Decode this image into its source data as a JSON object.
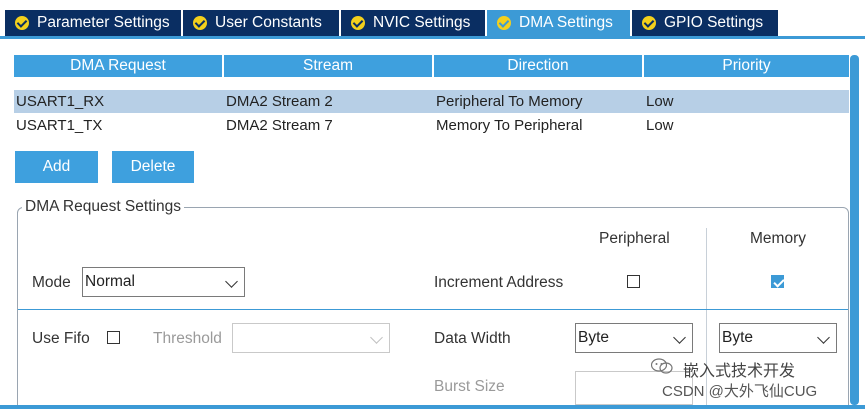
{
  "tabs": [
    {
      "label": "Parameter Settings",
      "active": false
    },
    {
      "label": "User Constants",
      "active": false
    },
    {
      "label": "NVIC Settings",
      "active": false
    },
    {
      "label": "DMA Settings",
      "active": true
    },
    {
      "label": "GPIO Settings",
      "active": false
    }
  ],
  "table": {
    "columns": [
      "DMA Request",
      "Stream",
      "Direction",
      "Priority"
    ],
    "rows": [
      [
        "USART1_RX",
        "DMA2 Stream 2",
        "Peripheral To Memory",
        "Low"
      ],
      [
        "USART1_TX",
        "DMA2 Stream 7",
        "Memory To Peripheral",
        "Low"
      ]
    ],
    "selected_row": 0
  },
  "buttons": {
    "add": "Add",
    "delete": "Delete"
  },
  "settings": {
    "legend": "DMA Request Settings",
    "peripheral_header": "Peripheral",
    "memory_header": "Memory",
    "mode_label": "Mode",
    "mode_value": "Normal",
    "increment_label": "Increment Address",
    "peripheral_increment": false,
    "memory_increment": true,
    "use_fifo_label": "Use Fifo",
    "use_fifo": false,
    "threshold_label": "Threshold",
    "threshold_value": "",
    "data_width_label": "Data Width",
    "peripheral_data_width": "Byte",
    "memory_data_width": "Byte",
    "burst_size_label": "Burst Size",
    "peripheral_burst_size": ""
  },
  "watermark": {
    "line1": "嵌入式技术开发",
    "line2": "CSDN @大外飞仙CUG"
  },
  "colors": {
    "tab_bg": "#0a2e62",
    "tab_active": "#3c9ad6",
    "header_bg": "#3ea0de",
    "selected_row": "#b7cfe6",
    "check_yellow": "#f3d01c"
  }
}
